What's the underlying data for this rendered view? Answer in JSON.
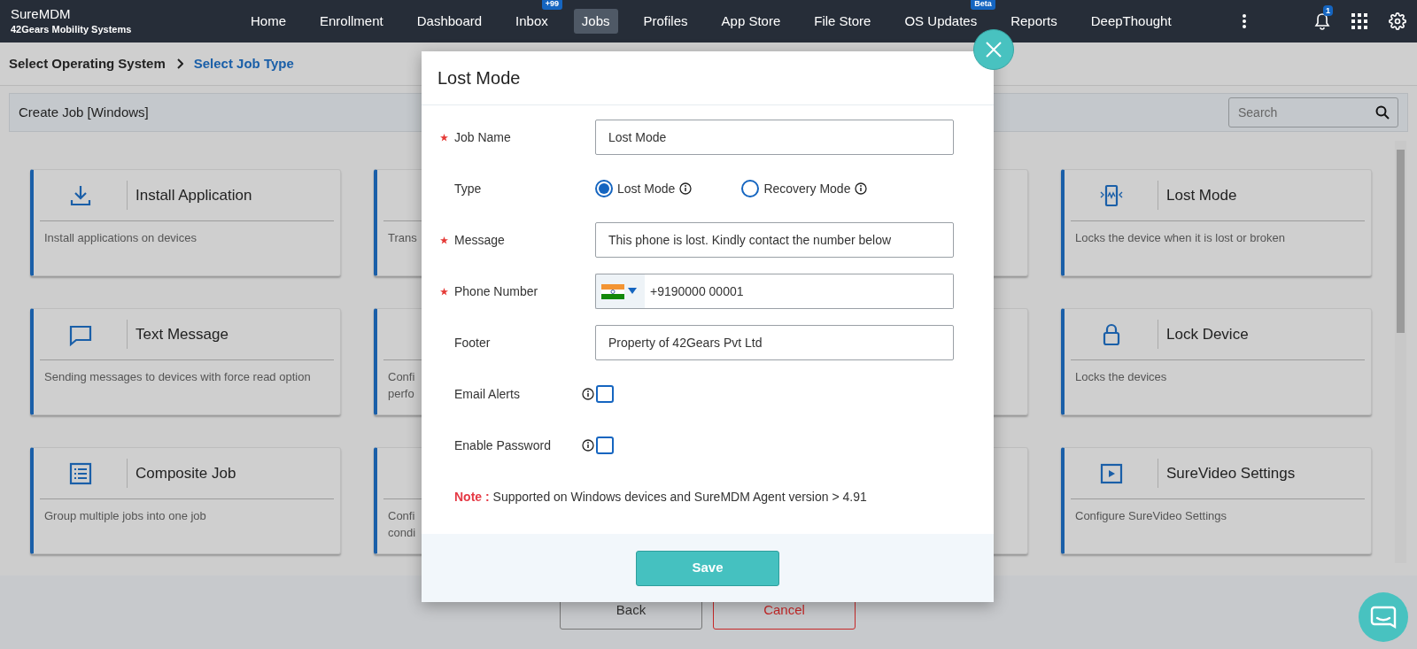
{
  "nav": {
    "brand": "SureMDM",
    "subtitle": "42Gears Mobility Systems",
    "notification_badge": "1",
    "items": [
      {
        "label": "Home",
        "selected": false
      },
      {
        "label": "Enrollment",
        "selected": false
      },
      {
        "label": "Dashboard",
        "selected": false
      },
      {
        "label": "Inbox",
        "selected": false,
        "badge": "+99"
      },
      {
        "label": "Jobs",
        "selected": true
      },
      {
        "label": "Profiles",
        "selected": false
      },
      {
        "label": "App Store",
        "selected": false
      },
      {
        "label": "File Store",
        "selected": false
      },
      {
        "label": "OS Updates",
        "selected": false,
        "badge": "Beta"
      },
      {
        "label": "Reports",
        "selected": false
      },
      {
        "label": "DeepThought",
        "selected": false
      }
    ]
  },
  "breadcrumb": [
    {
      "label": "Select Operating System",
      "selected": false
    },
    {
      "label": "Select Job Type",
      "selected": true
    }
  ],
  "panel": {
    "title": "Create Job [Windows]",
    "search": {
      "placeholder": "Search"
    }
  },
  "card_rows": [
    {
      "cards": [
        {
          "kind": "full",
          "title": "Install Application",
          "description": "Install applications on devices"
        },
        {
          "kind": "partial",
          "lines": [
            "Trans"
          ]
        },
        {
          "kind": "full",
          "title": "Lost Mode",
          "description": "Locks the device when it is lost or broken"
        }
      ]
    },
    {
      "cards": [
        {
          "kind": "full",
          "title": "Text Message",
          "description": "Sending messages to devices with force read option"
        },
        {
          "kind": "partial",
          "lines": [
            "Confi",
            "perfo"
          ]
        },
        {
          "kind": "full",
          "title": "Lock Device",
          "description": "Locks the devices"
        }
      ]
    },
    {
      "cards": [
        {
          "kind": "full",
          "title": "Composite Job",
          "description": "Group multiple jobs into one job"
        },
        {
          "kind": "partial",
          "lines": [
            "Confi",
            "condi"
          ]
        },
        {
          "kind": "full",
          "title": "SureVideo Settings",
          "description": "Configure SureVideo Settings"
        }
      ]
    }
  ],
  "footer_buttons": [
    {
      "kind": "default",
      "label": "Back"
    },
    {
      "kind": "danger",
      "label": "Cancel"
    }
  ],
  "modal": {
    "title": "Lost Mode",
    "save_label": "Save",
    "fields": [
      {
        "kind": "text",
        "label": "Job Name",
        "required": true,
        "value": "Lost Mode"
      },
      {
        "kind": "radio",
        "label": "Type",
        "required": false,
        "options": [
          {
            "label": "Lost Mode",
            "selected": true
          },
          {
            "label": "Recovery Mode",
            "selected": false
          }
        ]
      },
      {
        "kind": "text",
        "label": "Message",
        "required": true,
        "value": "This phone is lost. Kindly contact the number below"
      },
      {
        "kind": "phone",
        "label": "Phone Number",
        "required": true,
        "value": "+9190000 00001"
      },
      {
        "kind": "text",
        "label": "Footer",
        "required": false,
        "value": "Property of 42Gears Pvt Ltd"
      },
      {
        "kind": "checkbox",
        "label": "Email Alerts",
        "checked": false
      },
      {
        "kind": "checkbox",
        "label": "Enable Password",
        "checked": false
      }
    ],
    "note": {
      "label": "Note :",
      "text": "Supported on Windows devices and SureMDM Agent version > 4.91"
    }
  }
}
